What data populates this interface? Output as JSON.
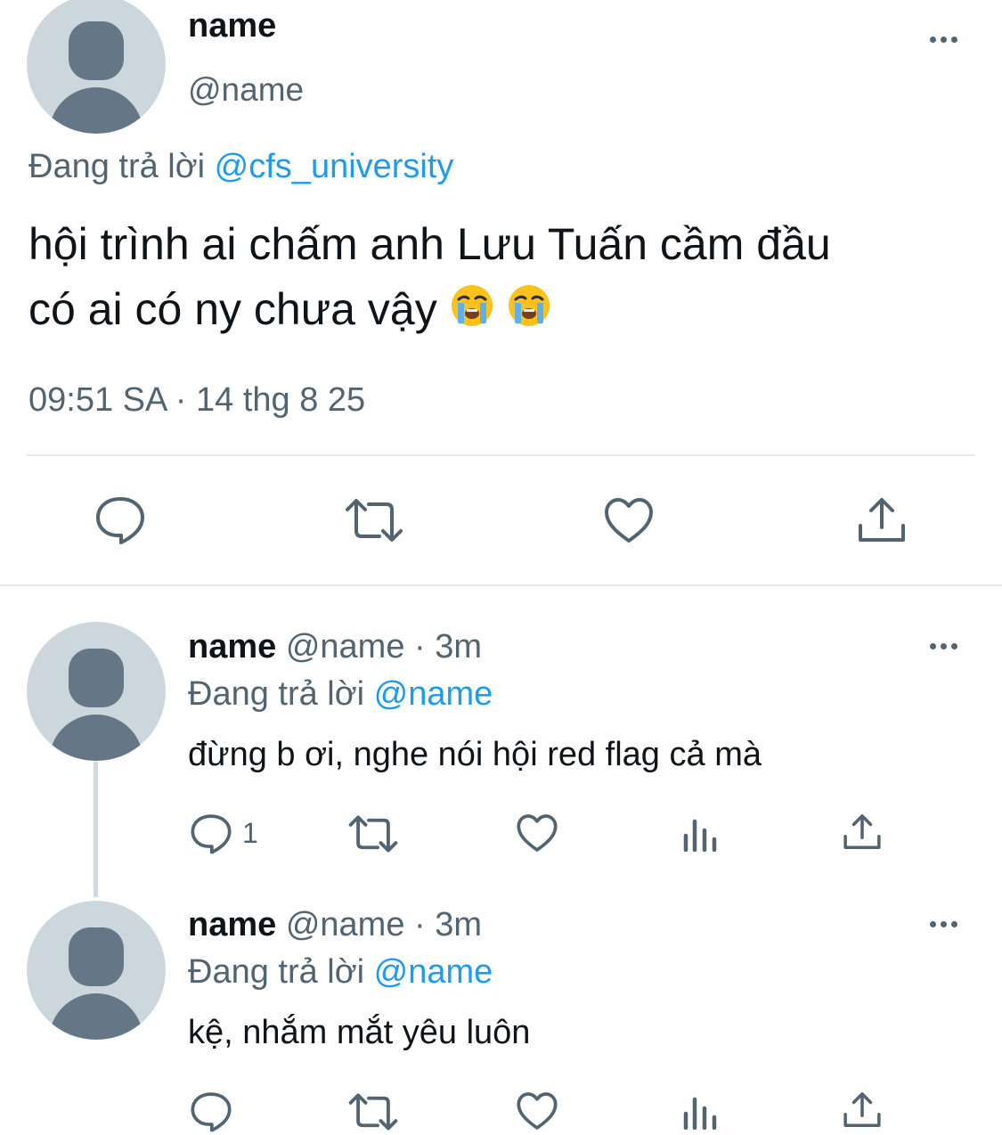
{
  "main_tweet": {
    "name": "name",
    "handle": "@name",
    "replying_prefix": "Đang trả lời",
    "replying_to": "@cfs_university",
    "text_line1": "hội trình ai chấm anh Lưu Tuấn cầm đầu",
    "text_line2": "có ai có ny chưa vậy",
    "emoji": "loudly-crying-face",
    "timestamp": "09:51 SA · 14 thg 8 25",
    "actions": [
      "reply-icon",
      "retweet-icon",
      "like-icon",
      "share-icon"
    ]
  },
  "replies": [
    {
      "name": "name",
      "handle": "@name",
      "time": "· 3m",
      "replying_prefix": "Đang trả lời",
      "replying_to": "@name",
      "text": "đừng b ơi, nghe nói hội red flag cả mà",
      "reply_count": "1"
    },
    {
      "name": "name",
      "handle": "@name",
      "time": "· 3m",
      "replying_prefix": "Đang trả lời",
      "replying_to": "@name",
      "text": "kệ, nhắm mắt yêu luôn",
      "reply_count": ""
    }
  ],
  "colors": {
    "text": "#0f1419",
    "secondary": "#536471",
    "accent": "#1d9bf0",
    "avatar_bg": "#ccd6dd",
    "avatar_fg": "#657786",
    "divider": "#e7e9ea"
  }
}
